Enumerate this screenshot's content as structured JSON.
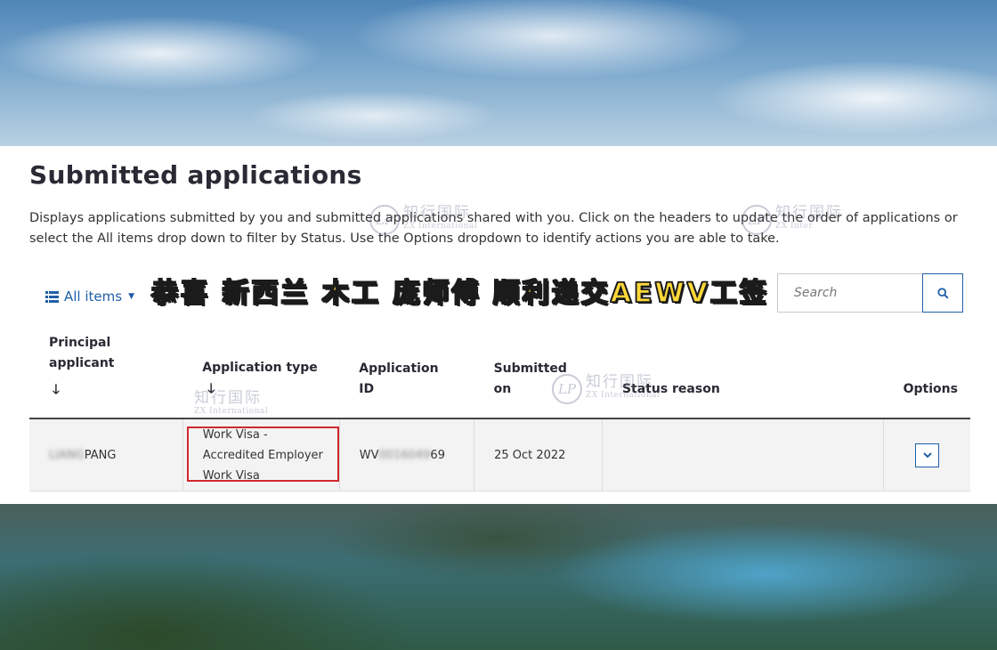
{
  "page": {
    "title": "Submitted applications",
    "description": "Displays applications submitted by you and submitted applications shared with you. Click on the headers to update the order of applications or select the All items drop down to filter by Status. Use the Options dropdown to identify actions you are able to take."
  },
  "filter": {
    "label": "All items",
    "icon": "list-icon"
  },
  "banner": {
    "text": "恭喜 新西兰 木工 庞师傅 顺利递交AEWV工签"
  },
  "search": {
    "placeholder": "Search",
    "icon": "search-icon"
  },
  "table": {
    "headers": {
      "principal_applicant": "Principal applicant",
      "application_type": "Application type",
      "application_id": "Application ID",
      "submitted_on": "Submitted on",
      "status_reason": "Status reason",
      "options": "Options"
    },
    "rows": [
      {
        "principal_applicant_hidden": "LIANG",
        "principal_applicant": "PANG",
        "application_type": "Work Visa - Accredited Employer Work Visa",
        "application_id_prefix": "WV",
        "application_id_hidden": "0016049",
        "application_id_suffix": "69",
        "submitted_on": "25 Oct 2022",
        "status_reason": ""
      }
    ]
  },
  "watermark": {
    "cn": "知行国际",
    "en": "ZX International",
    "short_en": "ZX Inter"
  },
  "colors": {
    "accent": "#1f5fa8",
    "highlight_box": "#d0282f",
    "banner_text": "#ffd83a"
  }
}
